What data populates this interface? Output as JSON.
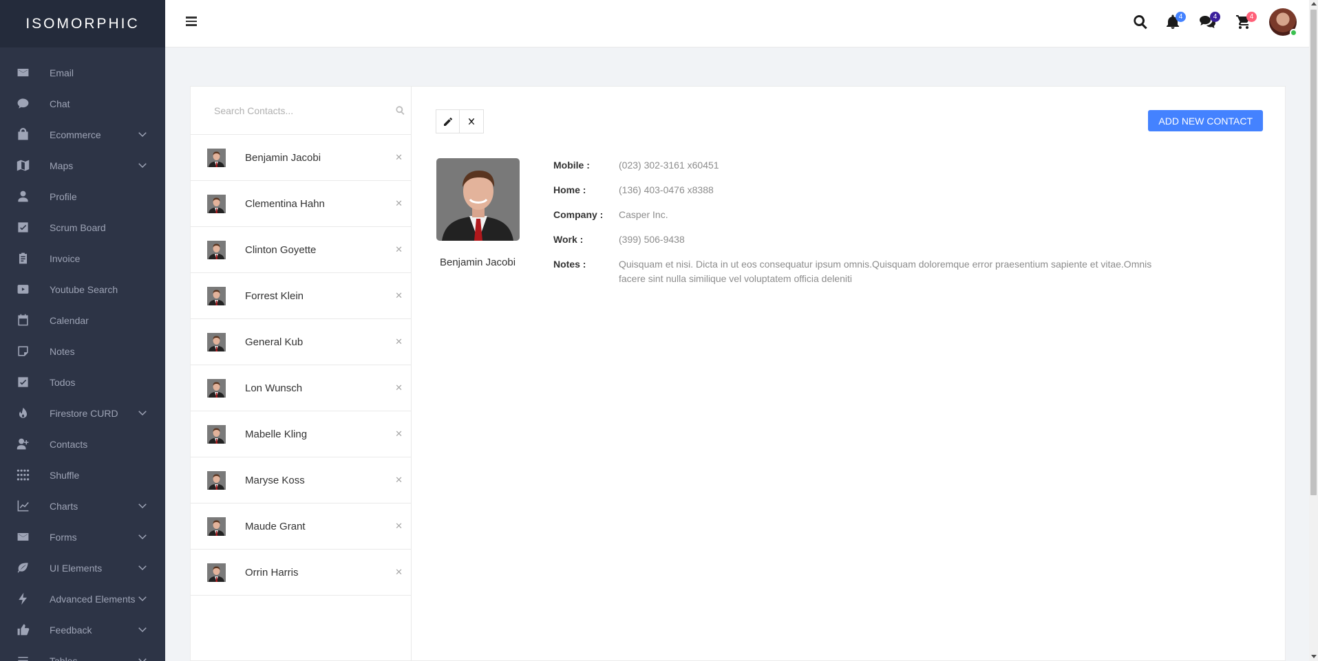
{
  "brand": {
    "logo_text": "ISOMORPHIC"
  },
  "sidebar": {
    "items": [
      {
        "label": "Email",
        "icon": "mail-icon",
        "has_submenu": false
      },
      {
        "label": "Chat",
        "icon": "chat-bubble-icon",
        "has_submenu": false
      },
      {
        "label": "Ecommerce",
        "icon": "shopping-bag-icon",
        "has_submenu": true
      },
      {
        "label": "Maps",
        "icon": "map-icon",
        "has_submenu": true
      },
      {
        "label": "Profile",
        "icon": "user-icon",
        "has_submenu": false
      },
      {
        "label": "Scrum Board",
        "icon": "check-square-icon",
        "has_submenu": false
      },
      {
        "label": "Invoice",
        "icon": "clipboard-icon",
        "has_submenu": false
      },
      {
        "label": "Youtube Search",
        "icon": "youtube-icon",
        "has_submenu": false
      },
      {
        "label": "Calendar",
        "icon": "calendar-icon",
        "has_submenu": false
      },
      {
        "label": "Notes",
        "icon": "note-icon",
        "has_submenu": false
      },
      {
        "label": "Todos",
        "icon": "check-square-icon",
        "has_submenu": false
      },
      {
        "label": "Firestore CURD",
        "icon": "flame-icon",
        "has_submenu": true
      },
      {
        "label": "Contacts",
        "icon": "user-add-icon",
        "has_submenu": false
      },
      {
        "label": "Shuffle",
        "icon": "grid-dots-icon",
        "has_submenu": false
      },
      {
        "label": "Charts",
        "icon": "line-chart-icon",
        "has_submenu": true
      },
      {
        "label": "Forms",
        "icon": "mail-icon",
        "has_submenu": true
      },
      {
        "label": "UI Elements",
        "icon": "leaf-icon",
        "has_submenu": true
      },
      {
        "label": "Advanced Elements",
        "icon": "lightning-icon",
        "has_submenu": true
      },
      {
        "label": "Feedback",
        "icon": "thumbs-up-icon",
        "has_submenu": true
      },
      {
        "label": "Tables",
        "icon": "list-icon",
        "has_submenu": true
      }
    ]
  },
  "topbar": {
    "notifications_count": "4",
    "messages_count": "4",
    "cart_count": "4",
    "colors": {
      "notifications_badge": "#4482ff",
      "messages_badge": "#3a1f9c",
      "cart_badge": "#ff6078"
    }
  },
  "contacts": {
    "search_placeholder": "Search Contacts...",
    "delete_glyph": "✕",
    "list": [
      {
        "name": "Benjamin Jacobi"
      },
      {
        "name": "Clementina Hahn"
      },
      {
        "name": "Clinton Goyette"
      },
      {
        "name": "Forrest Klein"
      },
      {
        "name": "General Kub"
      },
      {
        "name": "Lon Wunsch"
      },
      {
        "name": "Mabelle Kling"
      },
      {
        "name": "Maryse Koss"
      },
      {
        "name": "Maude Grant"
      },
      {
        "name": "Orrin Harris"
      }
    ]
  },
  "detail": {
    "add_button": "ADD NEW CONTACT",
    "name": "Benjamin Jacobi",
    "fields": [
      {
        "label": "Mobile :",
        "value": "(023) 302-3161 x60451"
      },
      {
        "label": "Home :",
        "value": "(136) 403-0476 x8388"
      },
      {
        "label": "Company :",
        "value": "Casper Inc."
      },
      {
        "label": "Work :",
        "value": "(399) 506-9438"
      },
      {
        "label": "Notes :",
        "value": "Quisquam et nisi. Dicta in ut eos consequatur ipsum omnis.Quisquam doloremque error praesentium sapiente et vitae.Omnis facere sint nulla similique vel voluptatem officia deleniti"
      }
    ]
  },
  "colors": {
    "sidebar_bg": "#2d3446",
    "logo_bg": "#242b3b",
    "accent": "#4482ff",
    "page_bg": "#f1f3f6"
  }
}
